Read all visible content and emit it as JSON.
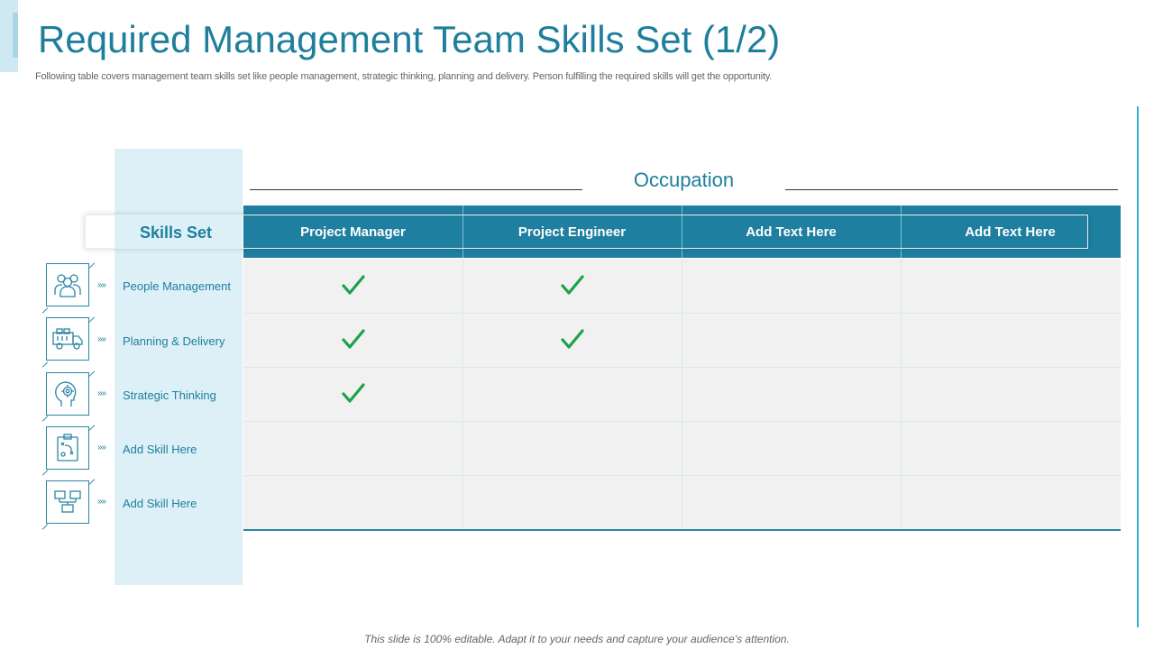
{
  "slide": {
    "title": "Required Management Team Skills Set (1/2)",
    "subtitle": "Following table covers management team skills set like people management, strategic thinking, planning and delivery. Person fulfilling the required skills will get the opportunity.",
    "footer": "This slide is 100% editable. Adapt it to your needs and capture your audience’s attention."
  },
  "table": {
    "occupation_label": "Occupation",
    "skills_header": "Skills Set",
    "columns": [
      "Project Manager",
      "Project Engineer",
      "Add Text Here",
      "Add Text Here"
    ],
    "rows": [
      {
        "label": "People Management",
        "icon": "people-group-icon",
        "arrow": "»»",
        "checks": [
          true,
          true,
          false,
          false
        ]
      },
      {
        "label": "Planning & Delivery",
        "icon": "delivery-truck-icon",
        "arrow": "»»",
        "checks": [
          true,
          true,
          false,
          false
        ]
      },
      {
        "label": "Strategic Thinking",
        "icon": "head-gear-icon",
        "arrow": "»»",
        "checks": [
          true,
          false,
          false,
          false
        ]
      },
      {
        "label": "Add Skill Here",
        "icon": "strategy-board-icon",
        "arrow": "»»",
        "checks": [
          false,
          false,
          false,
          false
        ]
      },
      {
        "label": "Add Skill Here",
        "icon": "network-computers-icon",
        "arrow": "»»",
        "checks": [
          false,
          false,
          false,
          false
        ]
      }
    ]
  },
  "colors": {
    "accent": "#1e7f9c",
    "header_bg": "#1f7fa0",
    "check": "#1aa34a",
    "skills_column_bg": "#ddf0f8"
  }
}
